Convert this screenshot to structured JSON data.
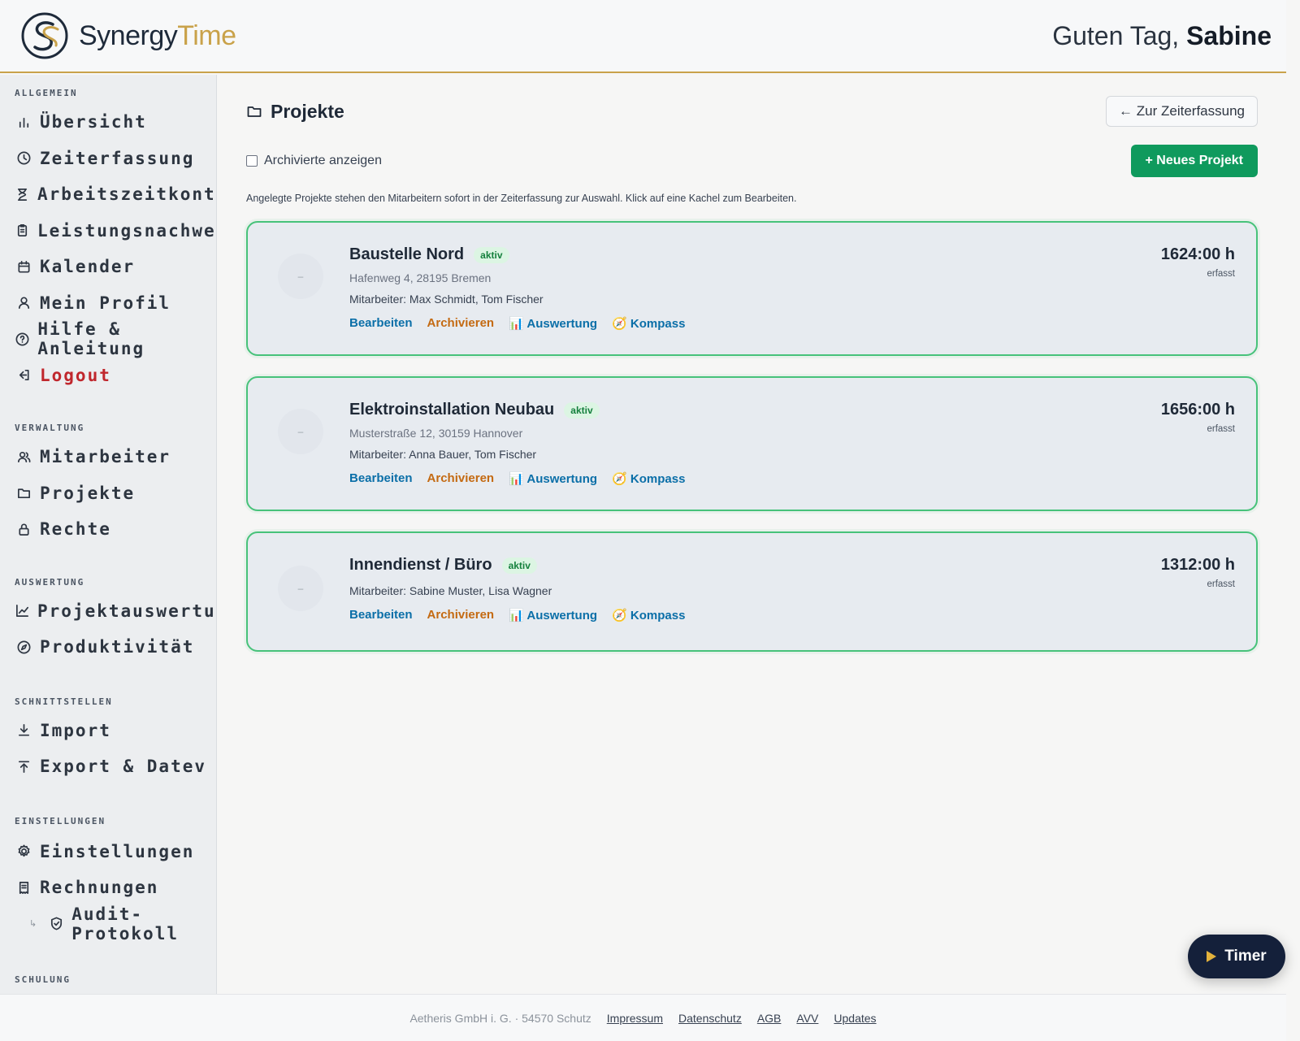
{
  "header": {
    "brand_part1": "Synergy",
    "brand_part2": "Time",
    "greeting_prefix": "Guten Tag,",
    "user_name": "Sabine"
  },
  "sidebar": {
    "sections": [
      {
        "label": "ALLGEMEIN",
        "items": [
          "Übersicht",
          "Zeiterfassung",
          "Arbeitszeitkonto",
          "Leistungsnachweis",
          "Kalender",
          "Mein Profil",
          "Hilfe & Anleitung",
          "Logout"
        ]
      },
      {
        "label": "VERWALTUNG",
        "items": [
          "Mitarbeiter",
          "Projekte",
          "Rechte"
        ]
      },
      {
        "label": "AUSWERTUNG",
        "items": [
          "Projektauswertung",
          "Produktivität"
        ]
      },
      {
        "label": "SCHNITTSTELLEN",
        "items": [
          "Import",
          "Export & Datev"
        ]
      },
      {
        "label": "EINSTELLUNGEN",
        "items": [
          "Einstellungen",
          "Rechnungen",
          "Audit-Protokoll"
        ]
      },
      {
        "label": "SCHULUNG",
        "items": []
      }
    ]
  },
  "main": {
    "title": "Projekte",
    "back_button": "← Zur Zeiterfassung",
    "show_archived_label": "Archivierte anzeigen",
    "new_project_button": "+ Neues Projekt",
    "hint": "Angelegte Projekte stehen den Mitarbeitern sofort in der Zeiterfassung zur Auswahl. Klick auf eine Kachel zum Bearbeiten.",
    "projects": [
      {
        "name": "Baustelle Nord",
        "status": "aktiv",
        "address": "Hafenweg 4, 28195 Bremen",
        "staff": "Mitarbeiter: Max Schmidt, Tom Fischer",
        "hours": "1624:00 h",
        "hours_label": "erfasst",
        "thumb": "–"
      },
      {
        "name": "Elektroinstallation Neubau",
        "status": "aktiv",
        "address": "Musterstraße 12, 30159 Hannover",
        "staff": "Mitarbeiter: Anna Bauer, Tom Fischer",
        "hours": "1656:00 h",
        "hours_label": "erfasst",
        "thumb": "–"
      },
      {
        "name": "Innendienst / Büro",
        "status": "aktiv",
        "address": "",
        "staff": "Mitarbeiter: Sabine Muster, Lisa Wagner",
        "hours": "1312:00 h",
        "hours_label": "erfasst",
        "thumb": "–"
      }
    ],
    "actions": {
      "edit": "Bearbeiten",
      "archive": "Archivieren",
      "evaluation": "📊 Auswertung",
      "compass": "🧭 Kompass"
    }
  },
  "timer": {
    "label": "Timer"
  },
  "footer": {
    "company": "Aetheris GmbH i. G. · 54570 Schutz",
    "links": [
      "Impressum",
      "Datenschutz",
      "AGB",
      "AVV",
      "Updates"
    ]
  },
  "colors": {
    "accent_gold": "#c9a24a",
    "primary_green": "#0f9a5d",
    "card_border": "#47c27a",
    "logout_red": "#c0272d",
    "timer_bg": "#14203a"
  }
}
